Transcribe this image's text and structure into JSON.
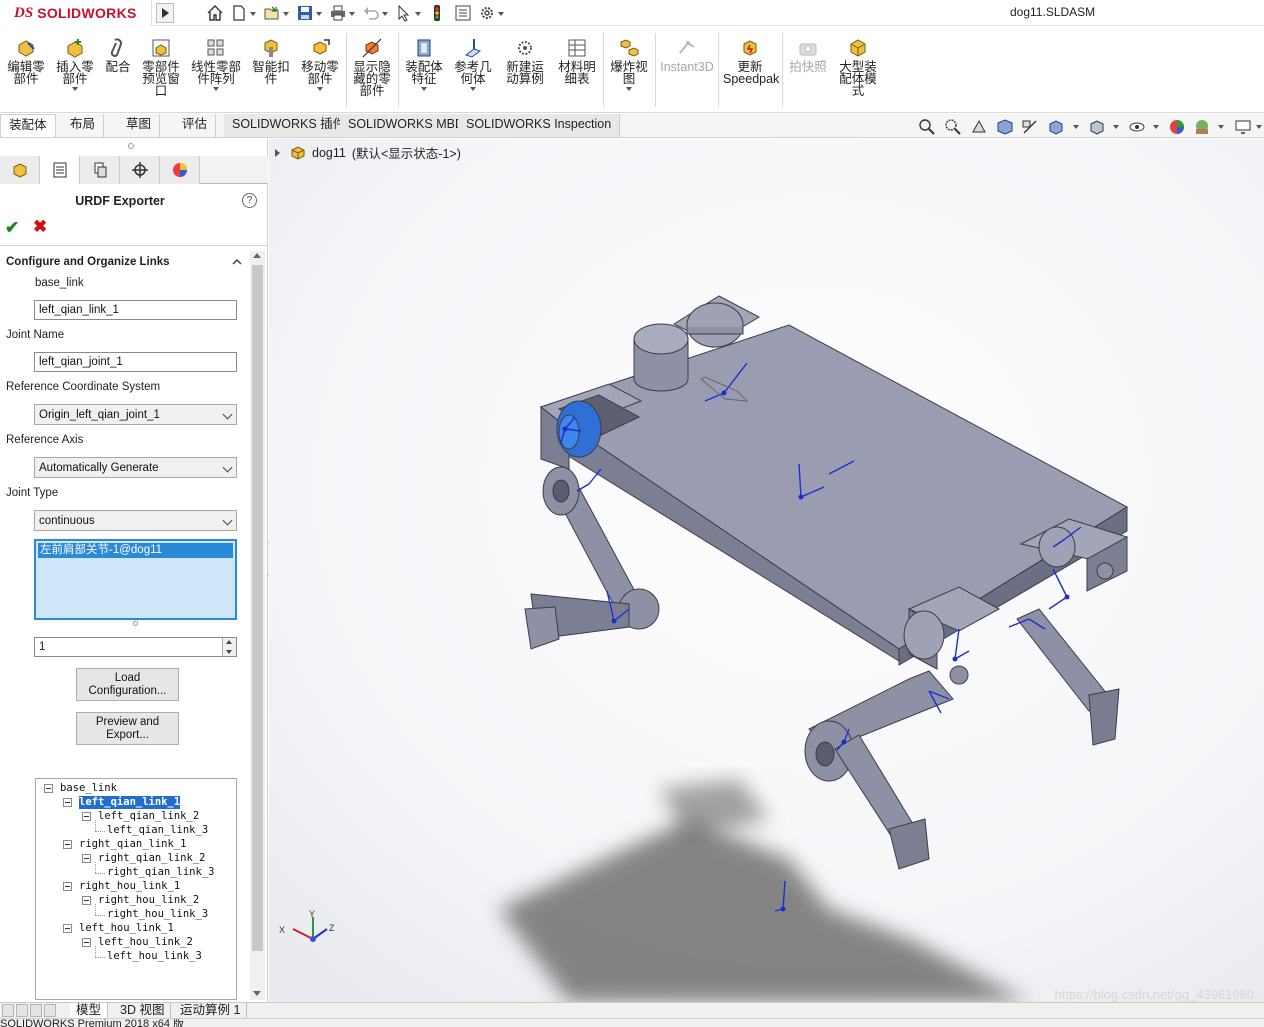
{
  "app": {
    "logo_mark": "DS",
    "logo_text": "SOLIDWORKS",
    "document_title": "dog11.SLDASM"
  },
  "quick_access": {
    "icons": [
      "home-icon",
      "new-file-icon",
      "open-file-icon",
      "save-icon",
      "print-icon",
      "undo-icon",
      "select-cursor-icon",
      "rebuild-traffic-light-icon",
      "file-properties-icon",
      "options-gear-icon"
    ]
  },
  "command_manager": {
    "commands": [
      {
        "label": "编辑零\n部件",
        "icon": "edit-component-icon"
      },
      {
        "label": "插入零\n部件",
        "icon": "insert-component-icon"
      },
      {
        "label": "配合",
        "icon": "mate-icon"
      },
      {
        "label": "零部件\n预览窗\n口",
        "icon": "component-preview-icon"
      },
      {
        "label": "线性零部\n件阵列",
        "icon": "linear-pattern-icon"
      },
      {
        "label": "智能扣\n件",
        "icon": "smart-fastener-icon"
      },
      {
        "label": "移动零\n部件",
        "icon": "move-component-icon"
      },
      {
        "label": "显示隐\n藏的零\n部件",
        "icon": "show-hidden-icon"
      },
      {
        "label": "装配体\n特征",
        "icon": "assembly-feature-icon"
      },
      {
        "label": "参考几\n何体",
        "icon": "reference-geometry-icon"
      },
      {
        "label": "新建运\n动算例",
        "icon": "new-motion-study-icon"
      },
      {
        "label": "材料明\n细表",
        "icon": "bill-of-materials-icon"
      },
      {
        "label": "爆炸视\n图",
        "icon": "exploded-view-icon"
      },
      {
        "label": "Instant3D",
        "icon": "instant3d-icon"
      },
      {
        "label": "更新\nSpeedpak",
        "icon": "speedpak-icon"
      },
      {
        "label": "拍快照",
        "icon": "snapshot-camera-icon"
      },
      {
        "label": "大型装\n配体模\n式",
        "icon": "large-assembly-icon"
      }
    ]
  },
  "command_tabs": [
    "装配体",
    "布局",
    "草图",
    "评估",
    "SOLIDWORKS 插件",
    "SOLIDWORKS MBD",
    "SOLIDWORKS Inspection"
  ],
  "heads_up_icons": [
    "zoom-to-fit-icon",
    "zoom-area-icon",
    "previous-view-icon",
    "section-view-icon",
    "dynamic-annotation-icon",
    "view-orientation-icon",
    "display-style-icon",
    "hide-show-items-icon",
    "edit-appearance-icon",
    "apply-scene-icon",
    "view-settings-icon"
  ],
  "property_manager": {
    "tab_icons": [
      "feature-manager-icon",
      "property-manager-icon",
      "configuration-manager-icon",
      "dimxpert-icon",
      "display-manager-icon"
    ],
    "title": "URDF Exporter",
    "help_label": "?",
    "ok_label": "✔",
    "cancel_label": "✖",
    "group_title": "Configure and Organize Links",
    "link_label": "base_link",
    "link_name_value": "left_qian_link_1",
    "joint_name_label": "Joint Name",
    "joint_name_value": "left_qian_joint_1",
    "ref_coord_label": "Reference Coordinate System",
    "ref_coord_value": "Origin_left_qian_joint_1",
    "ref_axis_label": "Reference Axis",
    "ref_axis_value": "Automatically Generate",
    "joint_type_label": "Joint Type",
    "joint_type_value": "continuous",
    "selected_component": "左前肩部关节-1@dog11",
    "child_count_value": "1",
    "load_button": "Load\nConfiguration...",
    "preview_button": "Preview and\nExport...",
    "link_tree": [
      {
        "label": "base_link",
        "level": 0,
        "selected": false
      },
      {
        "label": "left_qian_link_1",
        "level": 1,
        "selected": true
      },
      {
        "label": "left_qian_link_2",
        "level": 2,
        "selected": false
      },
      {
        "label": "left_qian_link_3",
        "level": 3,
        "selected": false
      },
      {
        "label": "right_qian_link_1",
        "level": 1,
        "selected": false
      },
      {
        "label": "right_qian_link_2",
        "level": 2,
        "selected": false
      },
      {
        "label": "right_qian_link_3",
        "level": 3,
        "selected": false
      },
      {
        "label": "right_hou_link_1",
        "level": 1,
        "selected": false
      },
      {
        "label": "right_hou_link_2",
        "level": 2,
        "selected": false
      },
      {
        "label": "right_hou_link_3",
        "level": 3,
        "selected": false
      },
      {
        "label": "left_hou_link_1",
        "level": 1,
        "selected": false
      },
      {
        "label": "left_hou_link_2",
        "level": 2,
        "selected": false
      },
      {
        "label": "left_hou_link_3",
        "level": 3,
        "selected": false
      }
    ]
  },
  "graphics": {
    "assembly_name": "dog11",
    "display_state": "(默认<显示状态-1>)",
    "triad_labels": {
      "x": "X",
      "y": "Y",
      "z": "Z"
    },
    "watermark": "https://blog.csdn.net/qq_43961980",
    "body_color": "#8e91a6",
    "selected_part_color": "#2f6fd6"
  },
  "bottom_tabs": [
    "模型",
    "3D 视图",
    "运动算例 1"
  ],
  "status_bar": "SOLIDWORKS Premium 2018 x64 版"
}
